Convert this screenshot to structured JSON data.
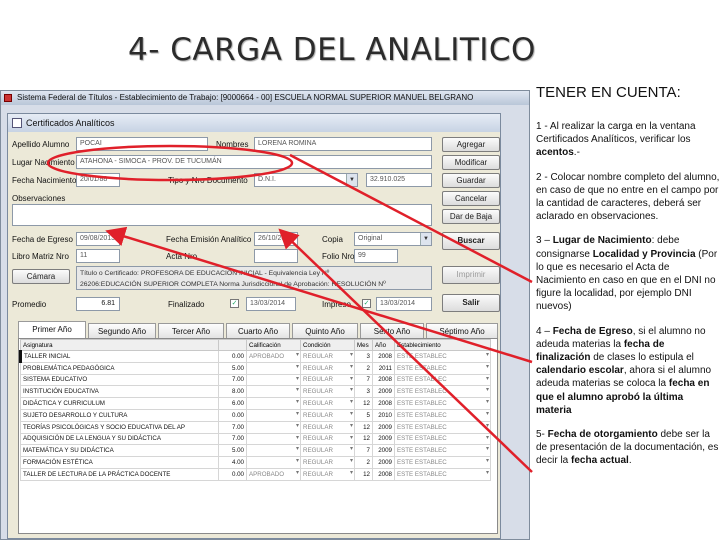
{
  "slide": {
    "title": "4- CARGA DEL ANALITICO"
  },
  "outer_window": {
    "title": "Sistema Federal de Títulos - Establecimiento de Trabajo: [9000664 - 00] ESCUELA NORMAL SUPERIOR MANUEL BELGRANO"
  },
  "form": {
    "title": "Certificados Analíticos",
    "apellido_label": "Apellido Alumno",
    "apellido_value": "POCAI",
    "nombres_label": "Nombres",
    "nombres_value": "LORENA ROMINA",
    "lugar_label": "Lugar Nacimiento",
    "lugar_value": "ATAHONA - SIMOCA - PROV. DE TUCUMÁN",
    "fecha_nac_label": "Fecha Nacimiento",
    "fecha_nac_value": "20/01/88",
    "tipo_doc_label": "Tipo y Nro Documento",
    "tipo_doc_value": "D.N.I.",
    "doc_number": "32.910.025",
    "obs_label": "Observaciones",
    "egreso_label": "Fecha de Egreso",
    "egreso_value": "09/08/2013",
    "emision_label": "Fecha Emisión Analítico",
    "emision_value": "26/10/2013",
    "copia_label": "Copia",
    "copia_value": "Original",
    "libro_label": "Libro Matriz Nro",
    "libro_value": "11",
    "acta_label": "Acta Nro",
    "folio_label": "Folio Nro",
    "folio_value": "99",
    "camera_button": "Cámara",
    "titulo_line1": "Título o Certificado: PROFESORA DE EDUCACIÓN INICIAL - Equivalencia Ley Nº",
    "titulo_line2": "26206:EDUCACIÓN SUPERIOR COMPLETA Norma Jurisdiccional de Aprobación: RESOLUCIÓN Nº",
    "promedio_label": "Promedio",
    "promedio_value": "6.81",
    "finalizado_label": "Finalizado",
    "finalizado_check": "✓",
    "finalizado_date": "13/03/2014",
    "impreso_label": "Impreso",
    "impreso_check": "✓",
    "impreso_date": "13/03/2014",
    "buttons": {
      "agregar": "Agregar",
      "modificar": "Modificar",
      "guardar": "Guardar",
      "cancelar": "Cancelar",
      "dar_de_baja": "Dar de Baja",
      "buscar": "Buscar",
      "imprimir": "Imprimir",
      "salir": "Salir"
    }
  },
  "tabs": [
    "Primer Año",
    "Segundo Año",
    "Tercer Año",
    "Cuarto Año",
    "Quinto Año",
    "Sexto Año",
    "Séptimo Año"
  ],
  "grid": {
    "headers": [
      "Asignatura",
      "",
      "Calificación",
      "Condición",
      "Mes",
      "Año",
      "Establecimiento"
    ],
    "rows": [
      [
        "TALLER INICIAL",
        "0.00",
        "APROBADO",
        "REGULAR",
        "3",
        "2008",
        "ESTE ESTABLEC"
      ],
      [
        "PROBLEMÁTICA PEDAGÓGICA",
        "5.00",
        "",
        "REGULAR",
        "2",
        "2011",
        "ESTE ESTABLEC"
      ],
      [
        "SISTEMA EDUCATIVO",
        "7.00",
        "",
        "REGULAR",
        "7",
        "2008",
        "ESTE ESTABLEC"
      ],
      [
        "INSTITUCIÓN EDUCATIVA",
        "8.00",
        "",
        "REGULAR",
        "3",
        "2009",
        "ESTE ESTABLEC"
      ],
      [
        "DIDÁCTICA Y CURRICULUM",
        "6.00",
        "",
        "REGULAR",
        "12",
        "2008",
        "ESTE ESTABLEC"
      ],
      [
        "SUJETO DESARROLLO Y CULTURA",
        "0.00",
        "",
        "REGULAR",
        "5",
        "2010",
        "ESTE ESTABLEC"
      ],
      [
        "TEORÍAS PSICOLÓGICAS Y SOCIO EDUCATIVA DEL AP",
        "7.00",
        "",
        "REGULAR",
        "12",
        "2009",
        "ESTE ESTABLEC"
      ],
      [
        "ADQUISICIÓN DE LA LENGUA Y SU DIDÁCTICA",
        "7.00",
        "",
        "REGULAR",
        "12",
        "2009",
        "ESTE ESTABLEC"
      ],
      [
        "MATEMÁTICA Y SU DIDÁCTICA",
        "5.00",
        "",
        "REGULAR",
        "7",
        "2009",
        "ESTE ESTABLEC"
      ],
      [
        "FORMACIÓN ESTÉTICA",
        "4.00",
        "",
        "REGULAR",
        "2",
        "2009",
        "ESTE ESTABLEC"
      ],
      [
        "TALLER DE LECTURA DE LA PRÁCTICA DOCENTE",
        "0.00",
        "APROBADO",
        "REGULAR",
        "12",
        "2008",
        "ESTE ESTABLEC"
      ]
    ]
  },
  "notes": {
    "heading": "TENER EN CUENTA:",
    "n1_a": "1 - Al realizar la carga en la ventana Certificados Analíticos, verificar los ",
    "n1_b": "acentos",
    "n1_c": ".-",
    "n2": "2 - Colocar nombre completo del alumno, en caso de que no entre en el campo por la cantidad de caracteres, deberá ser aclarado en observaciones.",
    "n3_a": "3 – ",
    "n3_b": "Lugar de Nacimiento",
    "n3_c": ": debe consignarse ",
    "n3_d": "Localidad y Provincia",
    "n3_e": " (Por lo que es necesario el Acta de Nacimiento en caso en que en el DNI no figure la localidad, por ejemplo DNI nuevos)",
    "n4_a": "4 – ",
    "n4_b": "Fecha de Egreso",
    "n4_c": ", si el alumno no adeuda materias la ",
    "n4_d": "fecha de finalización",
    "n4_e": " de clases lo estipula el ",
    "n4_f": "calendario escolar",
    "n4_g": ", ahora si el alumno adeuda materias se coloca la ",
    "n4_h": "fecha en que el alumno aprobó la última materia",
    "n5_a": "5- ",
    "n5_b": "Fecha de otorgamiento",
    "n5_c": " debe ser la de presentación de la documentación, es decir la ",
    "n5_d": "fecha actual",
    "n5_e": "."
  },
  "colors": {
    "annotation": "#e0202a",
    "window_bg": "#ece9d8"
  }
}
